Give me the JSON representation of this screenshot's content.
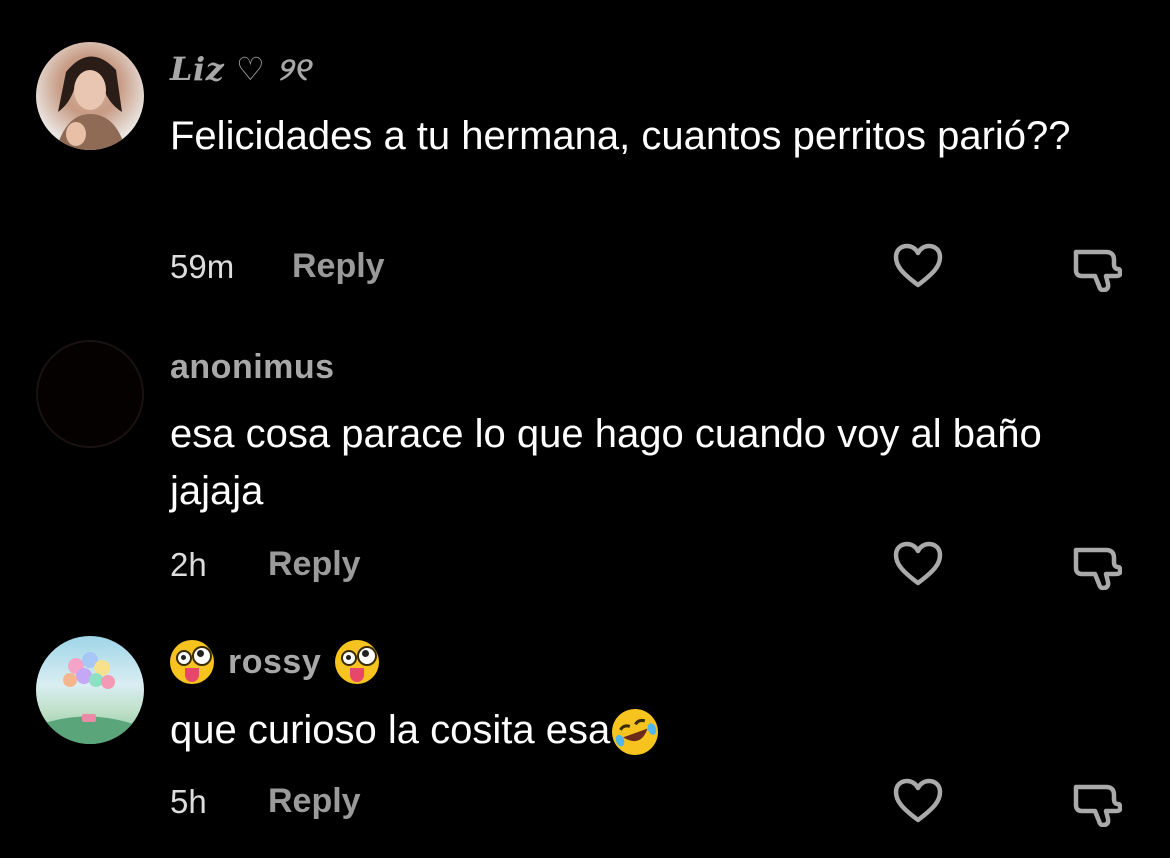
{
  "comments": [
    {
      "username": "Liz ♡ ୨୧",
      "text": "Felicidades a tu hermana, cuantos perritos parió??",
      "time": "59m",
      "reply_label": "Reply"
    },
    {
      "username": "anonimus",
      "text": "esa cosa parace lo que hago cuando voy al baño jajaja",
      "time": "2h",
      "reply_label": "Reply"
    },
    {
      "username": "rossy",
      "text": "que curioso la cosita esa",
      "time": "5h",
      "reply_label": "Reply"
    }
  ],
  "icons": {
    "like": "heart-outline-icon",
    "dislike": "thumbs-down-outline-icon"
  },
  "colors": {
    "background": "#000000",
    "username": "#a8a8a8",
    "reply": "#9a9a9a"
  }
}
